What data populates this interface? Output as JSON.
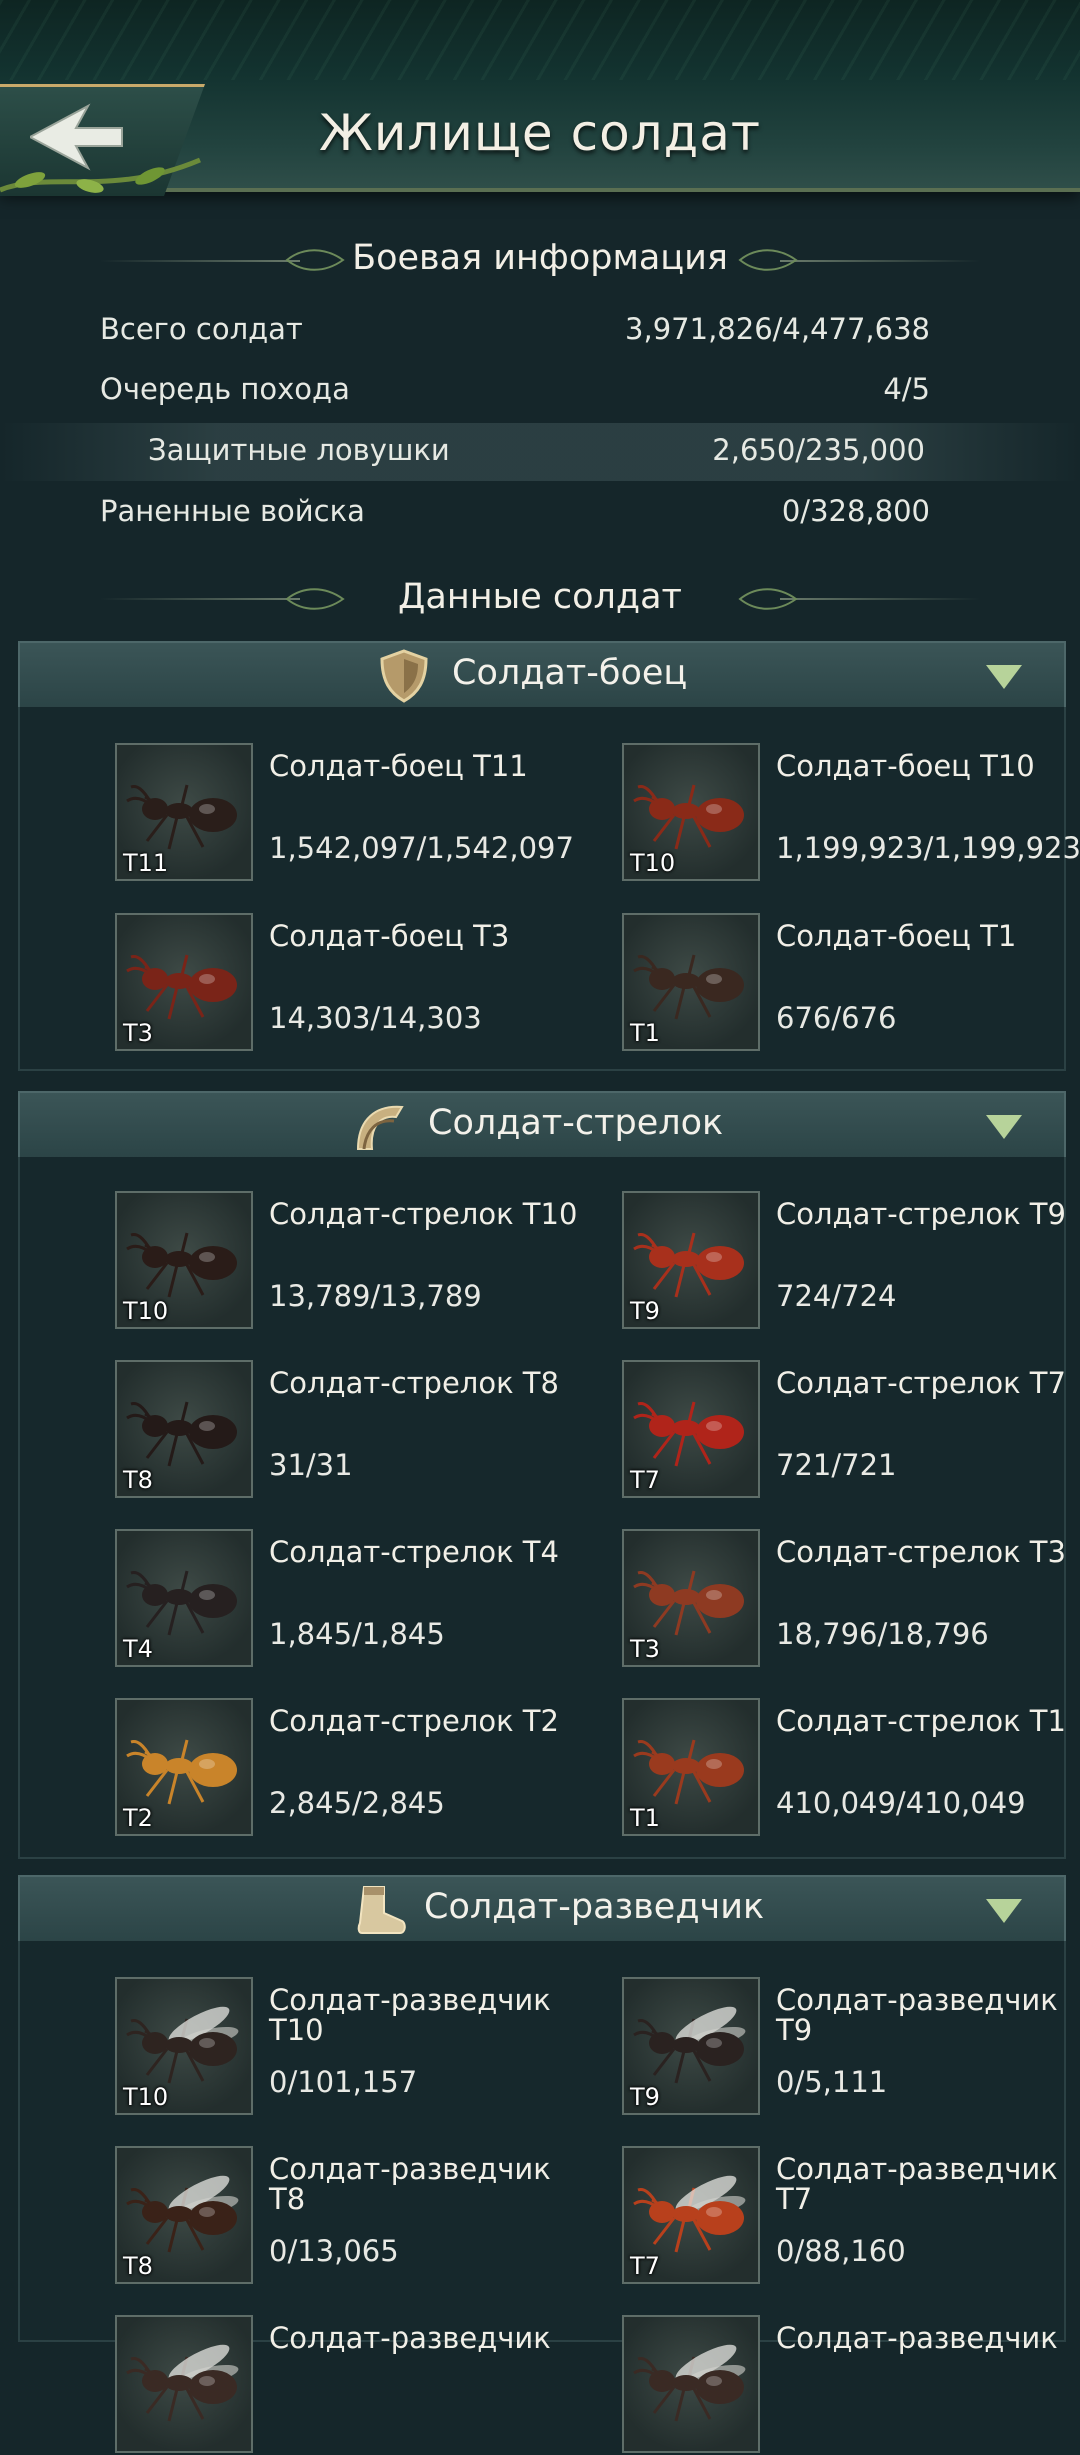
{
  "header": {
    "title": "Жилище солдат"
  },
  "battle_info": {
    "heading": "Боевая информация",
    "rows": [
      {
        "label": "Всего солдат",
        "value": "3,971,826/4,477,638"
      },
      {
        "label": "Очередь похода",
        "value": "4/5"
      },
      {
        "label": "Защитные ловушки",
        "value": "2,650/235,000"
      },
      {
        "label": "Раненные войска",
        "value": "0/328,800"
      }
    ]
  },
  "soldier_data": {
    "heading": "Данные солдат"
  },
  "categories": [
    {
      "name": "Солдат-боец",
      "icon": "shield-icon",
      "units": [
        {
          "name": "Солдат-боец T11",
          "count": "1,542,097/1,542,097",
          "tier": "T11",
          "color": "#2a1e1a"
        },
        {
          "name": "Солдат-боец T10",
          "count": "1,199,923/1,199,923",
          "tier": "T10",
          "color": "#8a2a18"
        },
        {
          "name": "Солдат-боец T3",
          "count": "14,303/14,303",
          "tier": "T3",
          "color": "#7a2418"
        },
        {
          "name": "Солдат-боец T1",
          "count": "676/676",
          "tier": "T1",
          "color": "#3a2820"
        }
      ]
    },
    {
      "name": "Солдат-стрелок",
      "icon": "archer-bow-icon",
      "units": [
        {
          "name": "Солдат-стрелок T10",
          "count": "13,789/13,789",
          "tier": "T10",
          "color": "#2a1c18"
        },
        {
          "name": "Солдат-стрелок T9",
          "count": "724/724",
          "tier": "T9",
          "color": "#a8301c"
        },
        {
          "name": "Солдат-стрелок T8",
          "count": "31/31",
          "tier": "T8",
          "color": "#241a18"
        },
        {
          "name": "Солдат-стрелок T7",
          "count": "721/721",
          "tier": "T7",
          "color": "#b0241a"
        },
        {
          "name": "Солдат-стрелок T4",
          "count": "1,845/1,845",
          "tier": "T4",
          "color": "#262020"
        },
        {
          "name": "Солдат-стрелок T3",
          "count": "18,796/18,796",
          "tier": "T3",
          "color": "#8e3a22"
        },
        {
          "name": "Солдат-стрелок T2",
          "count": "2,845/2,845",
          "tier": "T2",
          "color": "#c9842a"
        },
        {
          "name": "Солдат-стрелок T1",
          "count": "410,049/410,049",
          "tier": "T1",
          "color": "#9a3a1e"
        }
      ]
    },
    {
      "name": "Солдат-разведчик",
      "icon": "scout-boot-icon",
      "units": [
        {
          "name": "Солдат-разведчик T10",
          "count": "0/101,157",
          "tier": "T10",
          "color": "#2e2420"
        },
        {
          "name": "Солдат-разведчик T9",
          "count": "0/5,111",
          "tier": "T9",
          "color": "#2a2220"
        },
        {
          "name": "Солдат-разведчик T8",
          "count": "0/13,065",
          "tier": "T8",
          "color": "#3a2218"
        },
        {
          "name": "Солдат-разведчик T7",
          "count": "0/88,160",
          "tier": "T7",
          "color": "#b8401c"
        },
        {
          "name": "Солдат-разведчик",
          "count": "",
          "tier": "",
          "color": "#3a2a24"
        },
        {
          "name": "Солдат-разведчик",
          "count": "",
          "tier": "",
          "color": "#3a2a24"
        }
      ]
    }
  ]
}
